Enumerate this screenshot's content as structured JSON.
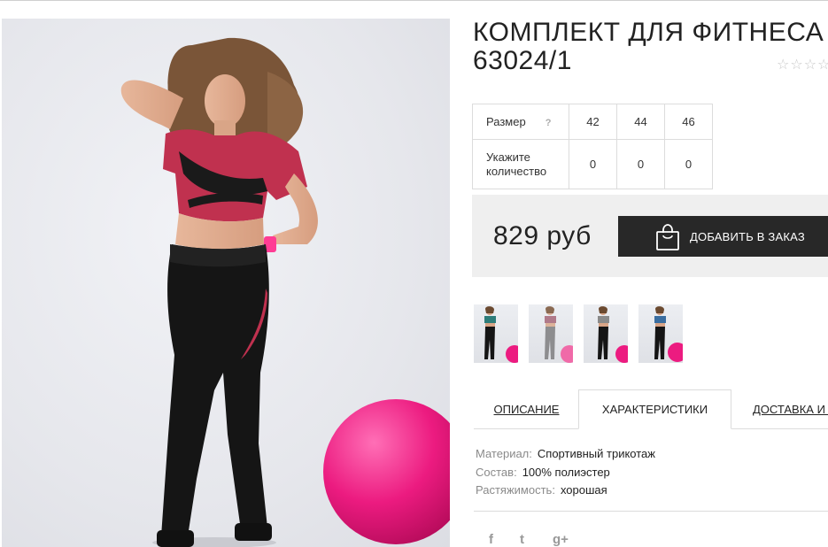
{
  "product": {
    "title_line1": "КОМПЛЕКТ ДЛЯ ФИТНЕСА",
    "title_line2": "63024/1",
    "rating": "☆☆☆☆"
  },
  "sizes": {
    "size_label": "Размер",
    "help": "?",
    "values": [
      "42",
      "44",
      "46"
    ],
    "qty_label_1": "Укажите",
    "qty_label_2": "количество",
    "quantities": [
      "0",
      "0",
      "0"
    ]
  },
  "purchase": {
    "price": "829 руб",
    "add_button": "ДОБАВИТЬ В ЗАКАЗ"
  },
  "tabs": {
    "description": "ОПИСАНИЕ",
    "characteristics": "ХАРАКТЕРИСТИКИ",
    "delivery": "ДОСТАВКА И О"
  },
  "characteristics": {
    "material_label": "Материал:",
    "material_value": "Спортивный трикотаж",
    "composition_label": "Состав:",
    "composition_value": "100% полиэстер",
    "stretch_label": "Растяжимость:",
    "stretch_value": "хорошая"
  },
  "social": {
    "facebook": "f",
    "twitter": "t",
    "gplus": "g+"
  },
  "colors": {
    "accent_dark": "#282828",
    "ball_pink": "#e8197a",
    "top_pink": "#c0314f"
  }
}
